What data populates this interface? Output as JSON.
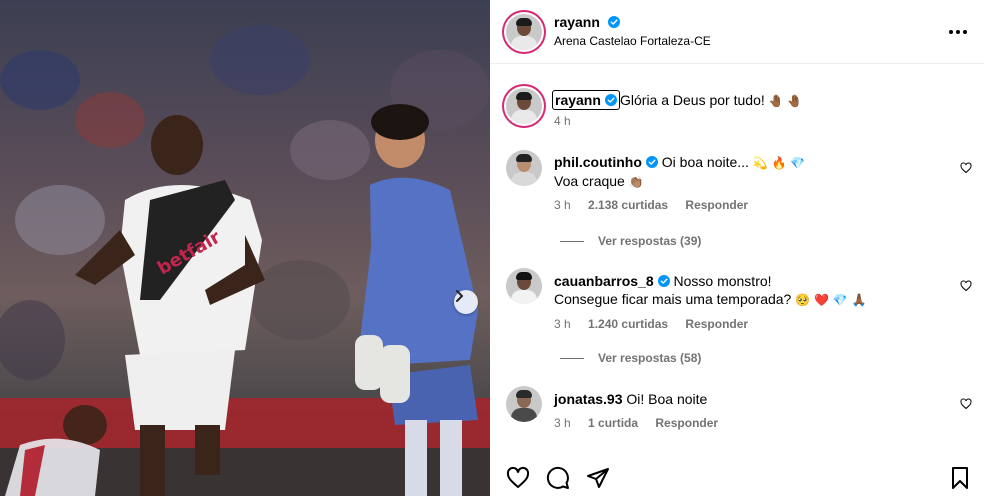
{
  "post": {
    "username": "rayann",
    "location": "Arena Castelao Fortaleza-CE"
  },
  "caption": {
    "username": "rayann",
    "text": "Glória a Deus por tudo!",
    "emojis": "🤚🏾 🤚🏾",
    "time": "4 h"
  },
  "comments": [
    {
      "username": "phil.coutinho",
      "text": "Oi boa noite...",
      "emojis": "💫 🔥 💎",
      "line2": "Voa craque",
      "line2_emoji": "👏🏽",
      "time": "3 h",
      "likes": "2.138 curtidas",
      "reply": "Responder",
      "view_replies": "Ver respostas (39)"
    },
    {
      "username": "cauanbarros_8",
      "text": "Nosso monstro!",
      "line2": "Consegue ficar mais uma temporada?",
      "line2_emoji": "🥺 ❤️ 💎 🙏🏾",
      "time": "3 h",
      "likes": "1.240 curtidas",
      "reply": "Responder",
      "view_replies": "Ver respostas (58)"
    },
    {
      "username": "jonatas.93",
      "text": "Oi! Boa noite",
      "time": "3 h",
      "likes": "1 curtida",
      "reply": "Responder"
    }
  ],
  "icons": {
    "more": "more-options-icon",
    "heart": "heart-icon",
    "comment": "comment-icon",
    "share": "share-icon",
    "save": "bookmark-icon",
    "verified": "verified-badge-icon",
    "next": "chevron-right-icon"
  },
  "colors": {
    "verified": "#0095f6",
    "secondary_text": "#737373",
    "story_ring": "#d62976"
  }
}
